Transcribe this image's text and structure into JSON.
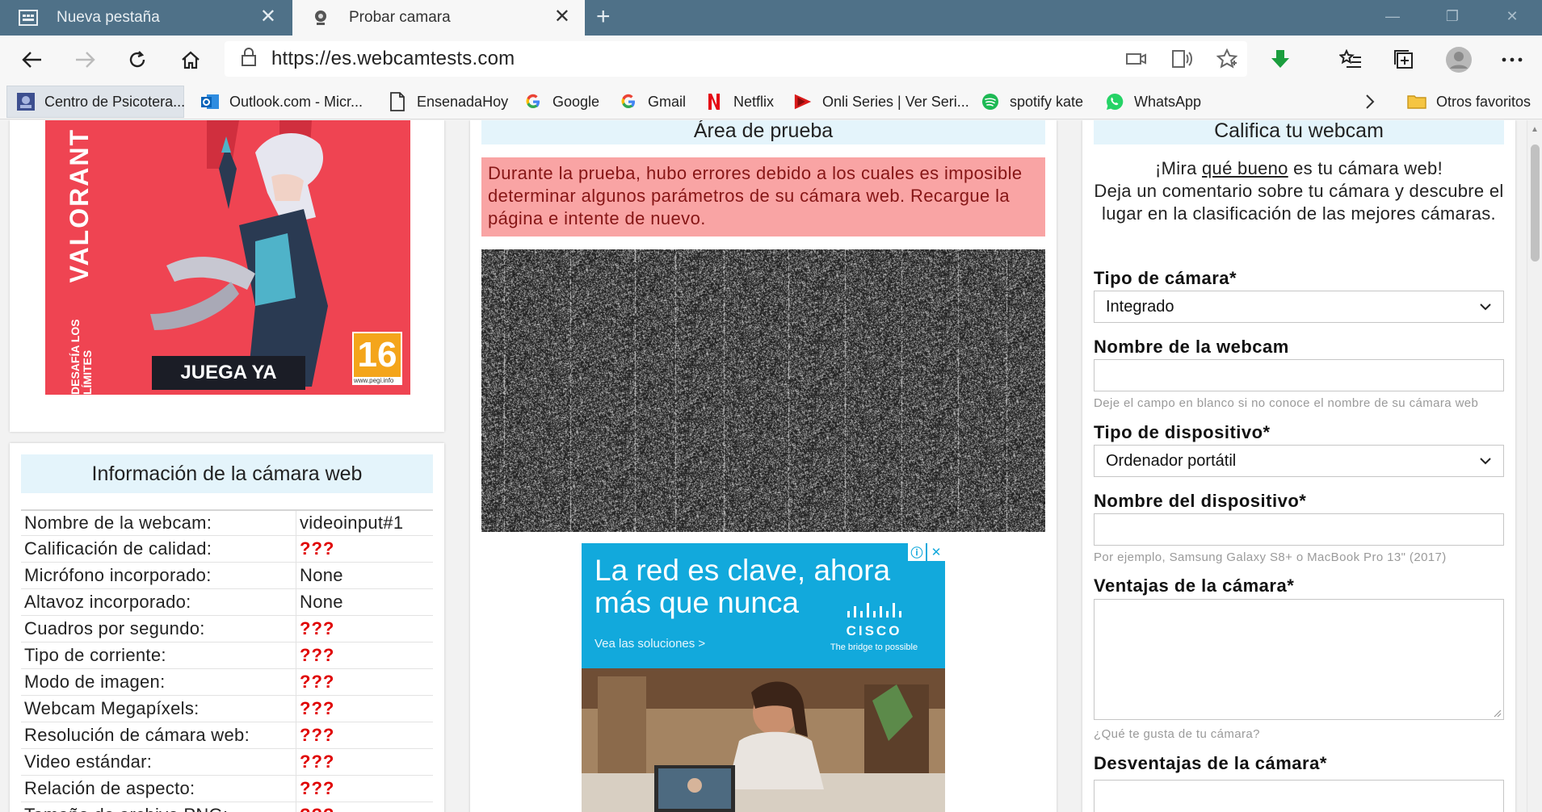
{
  "tabs": [
    {
      "title": "Nueva pestaña",
      "icon": "new-tab-page-icon"
    },
    {
      "title": "Probar camara",
      "icon": "webcam-icon"
    }
  ],
  "address": {
    "url": "https://es.webcamtests.com"
  },
  "bookmarks": [
    {
      "label": "Centro de Psicotera...",
      "icon": "psychology-center-icon"
    },
    {
      "label": "Outlook.com - Micr...",
      "icon": "outlook-icon",
      "color": "#0a64b8"
    },
    {
      "label": "EnsenadaHoy",
      "icon": "document-icon"
    },
    {
      "label": "Google",
      "icon": "google-icon"
    },
    {
      "label": "Gmail",
      "icon": "google-icon"
    },
    {
      "label": "Netflix",
      "icon": "netflix-icon",
      "color": "#e50914"
    },
    {
      "label": "Onli Series | Ver Seri...",
      "icon": "play-icon",
      "color": "#d91a1a"
    },
    {
      "label": "spotify kate",
      "icon": "spotify-icon",
      "color": "#1db954"
    },
    {
      "label": "WhatsApp",
      "icon": "whatsapp-icon",
      "color": "#25d366"
    }
  ],
  "other_favorites": "Otros favoritos",
  "ad_left": {
    "brand": "VALORANT",
    "sub": "DESAFÍA LOS LÍMITES",
    "cta": "JUEGA YA",
    "rating": "16",
    "rating_url": "www.pegi.info"
  },
  "info": {
    "title": "Información de la cámara web",
    "rows": [
      {
        "key": "Nombre de la webcam:",
        "value": "videoinput#1",
        "status": "ok"
      },
      {
        "key": "Calificación de calidad:",
        "value": "???",
        "status": "err"
      },
      {
        "key": "Micrófono incorporado:",
        "value": "None",
        "status": "ok"
      },
      {
        "key": "Altavoz incorporado:",
        "value": "None",
        "status": "ok"
      },
      {
        "key": "Cuadros por segundo:",
        "value": "???",
        "status": "err"
      },
      {
        "key": "Tipo de corriente:",
        "value": "???",
        "status": "err"
      },
      {
        "key": "Modo de imagen:",
        "value": "???",
        "status": "err"
      },
      {
        "key": "Webcam Megapíxels:",
        "value": "???",
        "status": "err"
      },
      {
        "key": "Resolución de cámara web:",
        "value": "???",
        "status": "err"
      },
      {
        "key": "Video estándar:",
        "value": "???",
        "status": "err"
      },
      {
        "key": "Relación de aspecto:",
        "value": "???",
        "status": "err"
      },
      {
        "key": "Tamaño de archivo PNG:",
        "value": "???",
        "status": "err"
      }
    ]
  },
  "test_area": {
    "title": "Área de prueba",
    "error": "Durante la prueba, hubo errores debido a los cuales es imposible determinar algunos parámetros de su cámara web. Recargue la página e intente de nuevo."
  },
  "ad_mid": {
    "headline_1": "La red es clave, ahora",
    "headline_2": "más que nunca",
    "cta": "Vea las soluciones >",
    "brand": "CISCO",
    "tagline": "The bridge to possible"
  },
  "rate": {
    "title": "Califica tu webcam",
    "intro_1": "¡Mira ",
    "intro_link": "qué bueno",
    "intro_2": " es tu cámara web!",
    "intro_3": "Deja un comentario sobre tu cámara y descubre el lugar en la clasificación de las mejores cámaras.",
    "camera_type_label": "Tipo de cámara*",
    "camera_type_value": "Integrado",
    "webcam_name_label": "Nombre de la webcam",
    "webcam_name_hint": "Deje el campo en blanco si no conoce el nombre de su cámara web",
    "device_type_label": "Tipo de dispositivo*",
    "device_type_value": "Ordenador portátil",
    "device_name_label": "Nombre del dispositivo*",
    "device_name_hint": "Por ejemplo, Samsung Galaxy S8+ o MacBook Pro 13\" (2017)",
    "pros_label": "Ventajas de la cámara*",
    "pros_hint": "¿Qué te gusta de tu cámara?",
    "cons_label": "Desventajas de la cámara*"
  }
}
